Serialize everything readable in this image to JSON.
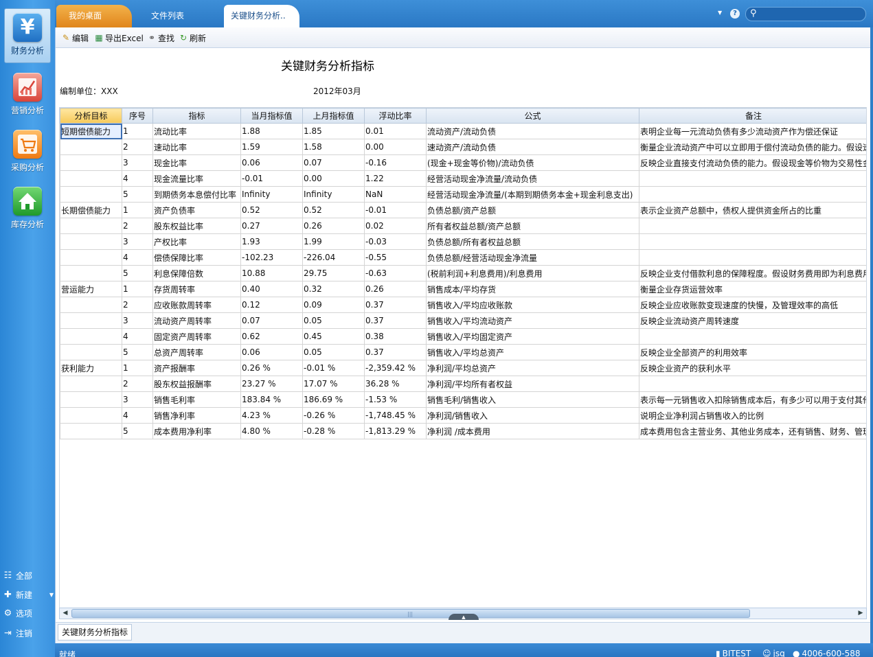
{
  "sidebar": {
    "nav": [
      {
        "label": "财务分析",
        "icon": "yen-icon",
        "active": true
      },
      {
        "label": "营销分析",
        "icon": "chart-icon",
        "active": false
      },
      {
        "label": "采购分析",
        "icon": "cart-icon",
        "active": false
      },
      {
        "label": "库存分析",
        "icon": "house-icon",
        "active": false
      }
    ],
    "links": [
      {
        "label": "全部",
        "icon": "tree-icon"
      },
      {
        "label": "新建",
        "icon": "new-icon"
      },
      {
        "label": "选项",
        "icon": "gear-icon"
      },
      {
        "label": "注销",
        "icon": "logout-icon"
      }
    ]
  },
  "tabs": [
    {
      "label": "我的桌面"
    },
    {
      "label": "文件列表"
    },
    {
      "label": "关键财务分析.."
    }
  ],
  "search": {
    "placeholder": ""
  },
  "toolbar": {
    "edit_label": "编辑",
    "export_label": "导出Excel",
    "find_label": "查找",
    "refresh_label": "刷新"
  },
  "report": {
    "title": "关键财务分析指标",
    "org_label": "编制单位：XXX",
    "period": "2012年03月"
  },
  "table": {
    "columns": [
      "分析目标",
      "序号",
      "指标",
      "当月指标值",
      "上月指标值",
      "浮动比率",
      "公式",
      "备注"
    ],
    "rows": [
      [
        "短期偿债能力",
        "1",
        "流动比率",
        "1.88",
        "1.85",
        "0.01",
        "流动资产/流动负债",
        "表明企业每一元流动负债有多少流动资产作为偿还保证"
      ],
      [
        "",
        "2",
        "速动比率",
        "1.59",
        "1.58",
        "0.00",
        "速动资产/流动负债",
        "衡量企业流动资产中可以立即用于偿付流动负债的能力。假设速"
      ],
      [
        "",
        "3",
        "现金比率",
        "0.06",
        "0.07",
        "-0.16",
        "(现金+现金等价物)/流动负债",
        "反映企业直接支付流动负债的能力。假设现金等价物为交易性金"
      ],
      [
        "",
        "4",
        "现金流量比率",
        "-0.01",
        "0.00",
        "1.22",
        "经营活动现金净流量/流动负债",
        ""
      ],
      [
        "",
        "5",
        "到期债务本息偿付比率",
        "Infinity",
        "Infinity",
        "NaN",
        "经营活动现金净流量/(本期到期债务本金+现金利息支出)",
        ""
      ],
      [
        "长期偿债能力",
        "1",
        "资产负债率",
        "0.52",
        "0.52",
        "-0.01",
        "负债总额/资产总额",
        "表示企业资产总额中，债权人提供资金所占的比重"
      ],
      [
        "",
        "2",
        "股东权益比率",
        "0.27",
        "0.26",
        "0.02",
        "所有者权益总额/资产总额",
        ""
      ],
      [
        "",
        "3",
        "产权比率",
        "1.93",
        "1.99",
        "-0.03",
        "负债总额/所有者权益总额",
        ""
      ],
      [
        "",
        "4",
        "偿债保障比率",
        "-102.23",
        "-226.04",
        "-0.55",
        "负债总额/经营活动现金净流量",
        ""
      ],
      [
        "",
        "5",
        "利息保障倍数",
        "10.88",
        "29.75",
        "-0.63",
        "(税前利润+利息费用)/利息费用",
        "反映企业支付借款利息的保障程度。假设财务费用即为利息费用"
      ],
      [
        "营运能力",
        "1",
        "存货周转率",
        "0.40",
        "0.32",
        "0.26",
        "销售成本/平均存货",
        "衡量企业存货运营效率"
      ],
      [
        "",
        "2",
        "应收账款周转率",
        "0.12",
        "0.09",
        "0.37",
        "销售收入/平均应收账款",
        "反映企业应收账款变现速度的快慢，及管理效率的高低"
      ],
      [
        "",
        "3",
        "流动资产周转率",
        "0.07",
        "0.05",
        "0.37",
        "销售收入/平均流动资产",
        "反映企业流动资产周转速度"
      ],
      [
        "",
        "4",
        "固定资产周转率",
        "0.62",
        "0.45",
        "0.38",
        "销售收入/平均固定资产",
        ""
      ],
      [
        "",
        "5",
        "总资产周转率",
        "0.06",
        "0.05",
        "0.37",
        "销售收入/平均总资产",
        "反映企业全部资产的利用效率"
      ],
      [
        "获利能力",
        "1",
        "资产报酬率",
        "0.26 %",
        "-0.01 %",
        "-2,359.42 %",
        "净利润/平均总资产",
        "反映企业资产的获利水平"
      ],
      [
        "",
        "2",
        "股东权益报酬率",
        "23.27 %",
        "17.07 %",
        "36.28 %",
        "净利润/平均所有者权益",
        ""
      ],
      [
        "",
        "3",
        "销售毛利率",
        "183.84 %",
        "186.69 %",
        "-1.53 %",
        "销售毛利/销售收入",
        "表示每一元销售收入扣除销售成本后，有多少可以用于支付其他"
      ],
      [
        "",
        "4",
        "销售净利率",
        "4.23 %",
        "-0.26 %",
        "-1,748.45 %",
        "净利润/销售收入",
        "说明企业净利润占销售收入的比例"
      ],
      [
        "",
        "5",
        "成本费用净利率",
        "4.80 %",
        "-0.28 %",
        "-1,813.29 %",
        "净利润 /成本费用",
        "成本费用包含主营业务、其他业务成本，还有销售、财务、管理"
      ]
    ]
  },
  "sheet_tab": "关键财务分析指标",
  "status": {
    "text": "就绪",
    "db": "BITEST",
    "user": "jsq",
    "phone": "4006-600-588"
  },
  "colors": {
    "accent": "#2f7fc9",
    "active_tab": "#e0851b",
    "header_highlight": "#f6c95a"
  }
}
